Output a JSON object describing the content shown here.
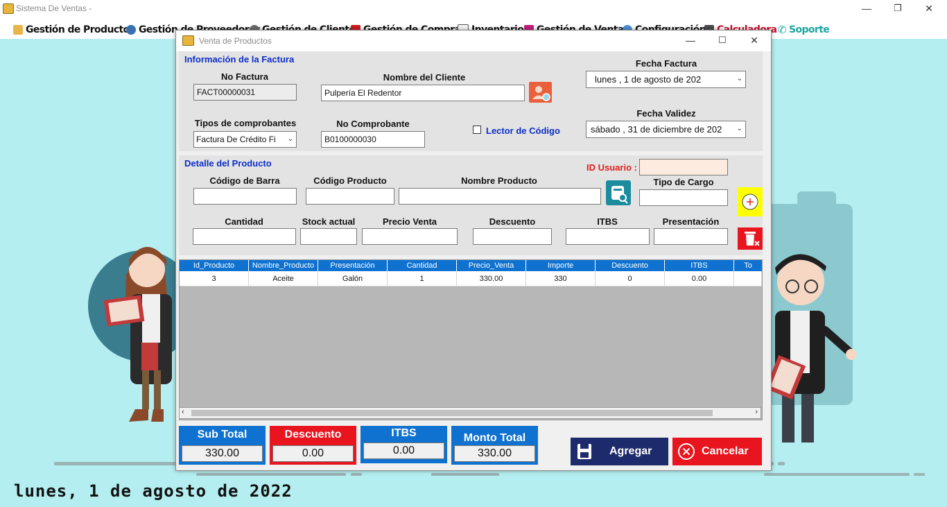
{
  "window": {
    "title": "Sistema De Ventas -"
  },
  "menu": [
    {
      "label": "Gestión de Productos"
    },
    {
      "label": "Gestión de Proveedores"
    },
    {
      "label": "Gestión de Clientes"
    },
    {
      "label": "Gestión de Compras"
    },
    {
      "label": "Inventario"
    },
    {
      "label": "Gestión de Ventas"
    },
    {
      "label": "Configuración"
    },
    {
      "label": "Calculadora"
    },
    {
      "label": "Soporte"
    }
  ],
  "status": {
    "date_text": "lunes, 1 de agosto de 2022"
  },
  "dialog": {
    "title": "Venta de Productos",
    "factura": {
      "section_title": "Información de la Factura",
      "no_factura_label": "No Factura",
      "no_factura_value": "FACT00000031",
      "cliente_label": "Nombre del Cliente",
      "cliente_value": "Pulpería El Redentor",
      "fecha_factura_label": "Fecha Factura",
      "fecha_factura_value": "lunes    ,   1 de    agosto    de 202",
      "tipos_label": "Tipos de comprobantes",
      "tipos_value": "Factura De Crédito Fi",
      "no_comprobante_label": "No Comprobante",
      "no_comprobante_value": "B0100000030",
      "lector_label": "Lector de Código",
      "fecha_validez_label": "Fecha Validez",
      "fecha_validez_value": "sábado  , 31 de  diciembre  de 202"
    },
    "detalle": {
      "section_title": "Detalle del Producto",
      "id_usuario_label": "ID Usuario :",
      "codigo_barra_label": "Código de Barra",
      "codigo_producto_label": "Código Producto",
      "nombre_producto_label": "Nombre Producto",
      "tipo_cargo_label": "Tipo de Cargo",
      "cantidad_label": "Cantidad",
      "stock_label": "Stock actual",
      "precio_label": "Precio Venta",
      "descuento_label": "Descuento",
      "itbs_label": "ITBS",
      "presentacion_label": "Presentación"
    },
    "table": {
      "columns": [
        "Id_Producto",
        "Nombre_Producto",
        "Presentación",
        "Cantidad",
        "Precio_Venta",
        "Importe",
        "Descuento",
        "ITBS",
        "To"
      ],
      "rows": [
        [
          "3",
          "Aceite",
          "Galón",
          "1",
          "330.00",
          "330",
          "0",
          "0.00",
          ""
        ]
      ]
    },
    "totals": {
      "subtotal_label": "Sub Total",
      "subtotal_value": "330.00",
      "descuento_label": "Descuento",
      "descuento_value": "0.00",
      "itbs_label": "ITBS",
      "itbs_value": "0.00",
      "monto_label": "Monto Total",
      "monto_value": "330.00"
    },
    "buttons": {
      "agregar": "Agregar",
      "cancelar": "Cancelar"
    }
  },
  "colors": {
    "desktop": "#b4eef0",
    "accent_blue": "#0f72d0",
    "danger_red": "#e8141e",
    "navy": "#1d2a6b"
  }
}
